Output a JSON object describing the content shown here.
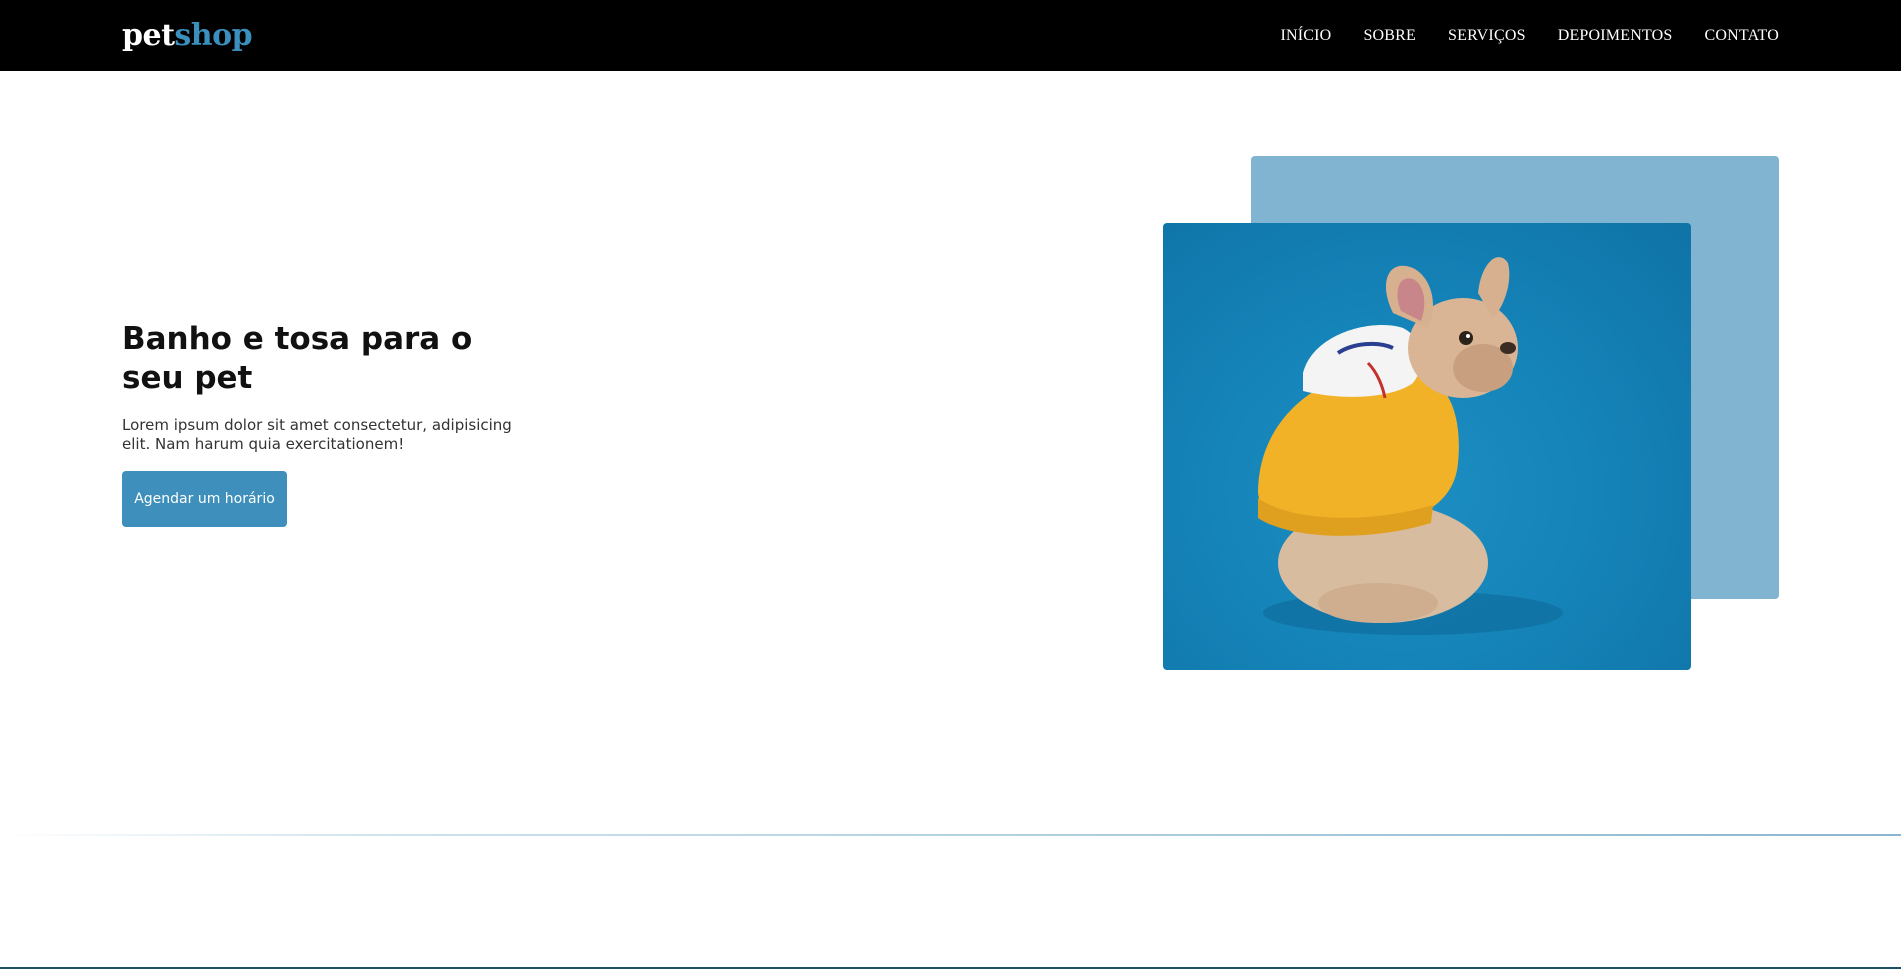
{
  "header": {
    "logo_part1": "pet",
    "logo_part2": "shop",
    "nav": [
      "INÍCIO",
      "SOBRE",
      "SERVIÇOS",
      "DEPOIMENTOS",
      "CONTATO"
    ]
  },
  "hero": {
    "title": "Banho e tosa para o seu pet",
    "description": "Lorem ipsum dolor sit amet consectetur, adipisicing elit. Nam harum quia exercitationem!",
    "cta_label": "Agendar um horário"
  },
  "colors": {
    "accent": "#3e8fbb",
    "logo_accent": "#3a8fbd",
    "back_card": "#80b4d1",
    "header_bg": "#000000"
  }
}
